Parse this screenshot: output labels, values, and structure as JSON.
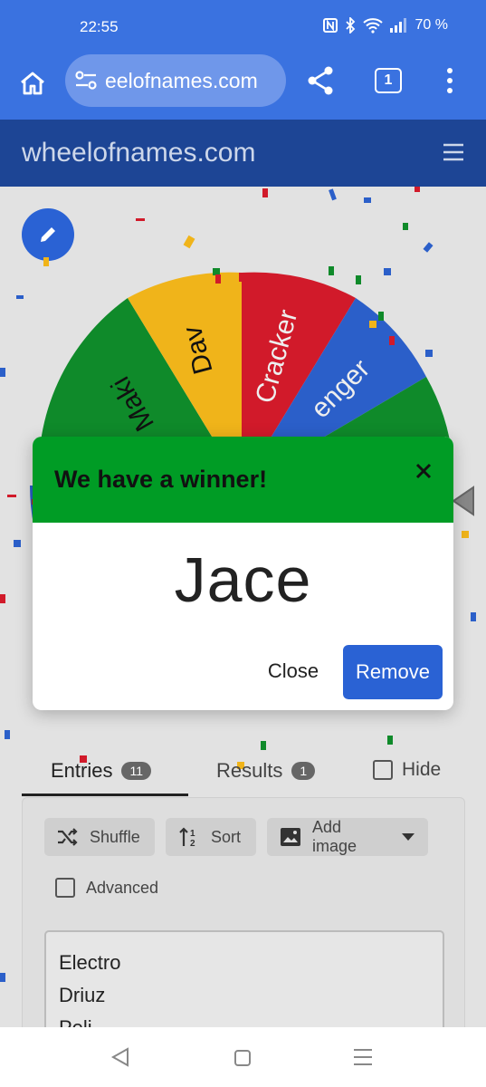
{
  "status_bar": {
    "time": "22:55",
    "battery": "70 %"
  },
  "browser": {
    "url": "eelofnames.com",
    "tab_count": "1"
  },
  "site": {
    "title": "wheelofnames.com"
  },
  "wheel": {
    "segments": [
      {
        "label": "Maki",
        "color": "#0f8a2a"
      },
      {
        "label": "Dav",
        "color": "#f0b41a"
      },
      {
        "label": "Cracker",
        "color": "#d11a2a"
      },
      {
        "label": "enger",
        "color": "#2b5fc9"
      }
    ]
  },
  "dialog": {
    "title": "We have a winner!",
    "winner": "Jace",
    "close_label": "Close",
    "remove_label": "Remove"
  },
  "tabs": {
    "entries_label": "Entries",
    "entries_count": "11",
    "results_label": "Results",
    "results_count": "1",
    "hide_label": "Hide"
  },
  "toolbar": {
    "shuffle_label": "Shuffle",
    "sort_label": "Sort",
    "add_image_label": "Add image",
    "advanced_label": "Advanced"
  },
  "entries": [
    "Electro",
    "Driuz",
    "Peli"
  ],
  "colors": {
    "browser_blue": "#3a72e0",
    "header_blue": "#1d4595",
    "winner_green": "#009c25",
    "primary_button": "#2a62d4"
  }
}
